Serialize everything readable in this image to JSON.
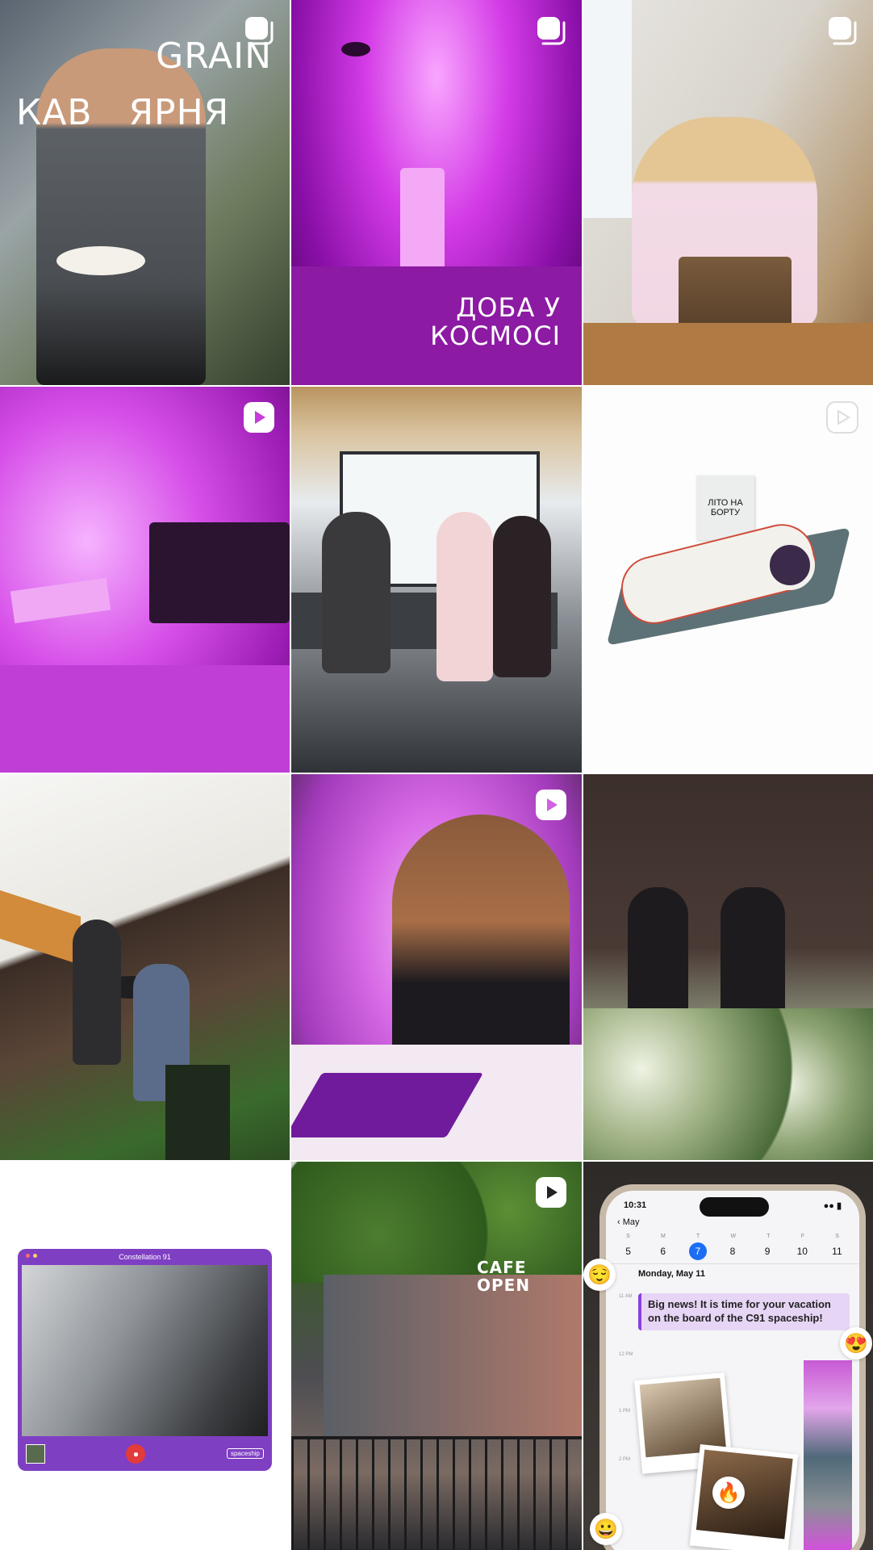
{
  "grid": {
    "tiles": [
      {
        "id": 1,
        "type": "carousel",
        "overlay_lines": [
          "GRAIN",
          "КАВ   ЯРНЯ"
        ]
      },
      {
        "id": 2,
        "type": "carousel",
        "overlay_lines": [
          "ДОБА У",
          "КОСМОСІ"
        ]
      },
      {
        "id": 3,
        "type": "carousel",
        "overlay_lines": []
      },
      {
        "id": 4,
        "type": "reel",
        "overlay_lines": []
      },
      {
        "id": 5,
        "type": "image",
        "overlay_lines": []
      },
      {
        "id": 6,
        "type": "reel",
        "overlay_lines": [],
        "sign_text": "ЛІТО НА БОРТУ"
      },
      {
        "id": 7,
        "type": "image",
        "overlay_lines": []
      },
      {
        "id": 8,
        "type": "reel",
        "overlay_lines": []
      },
      {
        "id": 9,
        "type": "image",
        "overlay_lines": []
      },
      {
        "id": 10,
        "type": "image",
        "overlay_lines": [],
        "card_title": "Constellation 91",
        "card_brand": "spaceship"
      },
      {
        "id": 11,
        "type": "reel",
        "overlay_lines": [],
        "sign_text": "CAFE OPEN"
      },
      {
        "id": 12,
        "type": "image",
        "overlay_lines": [],
        "phone": {
          "time": "10:31",
          "back_label": "May",
          "weekday_letters": [
            "S",
            "M",
            "T",
            "W",
            "T",
            "F",
            "S"
          ],
          "days": [
            "5",
            "6",
            "7",
            "8",
            "9",
            "10",
            "11"
          ],
          "selected_day": "7",
          "date_heading": "Monday, May 11",
          "hours": [
            "11 AM",
            "12 PM",
            "1 PM",
            "2 PM"
          ],
          "event_text": "Big news! It is time for your vacation on the board of the C91 spaceship!"
        }
      }
    ]
  },
  "icons": {
    "carousel": "carousel-icon",
    "reel": "reel-play-icon"
  },
  "colors": {
    "badge": "#ffffff",
    "selected_day": "#1b6ef3",
    "event_accent": "#8a3fe0",
    "card_purple": "#7f3fc3"
  }
}
